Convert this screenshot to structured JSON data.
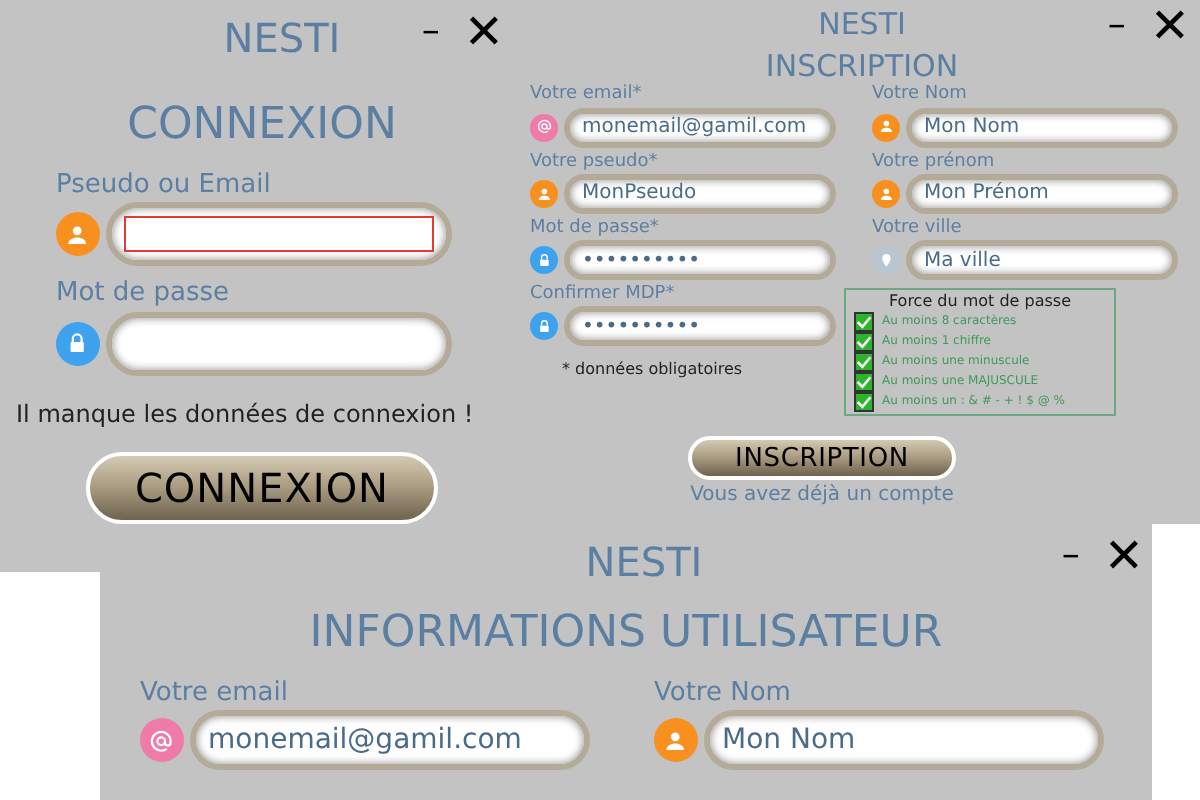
{
  "login_window": {
    "app_title": "NESTI",
    "minimize": "–",
    "close": "✕",
    "heading": "CONNEXION",
    "fields": [
      {
        "label": "Pseudo ou Email",
        "kind": "user",
        "invalid": true
      },
      {
        "label": "Mot de passe",
        "kind": "password",
        "invalid": false
      }
    ],
    "error": "Il manque les données de connexion !",
    "button": "CONNEXION"
  },
  "signup_window": {
    "app_title": "NESTI",
    "minimize": "–",
    "close": "✕",
    "heading": "INSCRIPTION",
    "left_fields": [
      {
        "label": "Votre email*",
        "kind": "email",
        "value": "monemail@gamil.com"
      },
      {
        "label": "Votre pseudo*",
        "kind": "user",
        "value": "MonPseudo"
      },
      {
        "label": "Mot de passe*",
        "kind": "password",
        "value": "••••••••••"
      },
      {
        "label": "Confirmer MDP*",
        "kind": "password",
        "value": "••••••••••"
      }
    ],
    "right_fields": [
      {
        "label": "Votre Nom",
        "kind": "user",
        "value": "Mon Nom"
      },
      {
        "label": "Votre prénom",
        "kind": "user",
        "value": "Mon Prénom"
      },
      {
        "label": "Votre ville",
        "kind": "city",
        "value": "Ma ville"
      }
    ],
    "required_note": "* données obligatoires",
    "strength": {
      "title": "Force du mot de passe",
      "rules": [
        {
          "text": "Au moins 8 caractères",
          "checked": true
        },
        {
          "text": "Au moins 1 chiffre",
          "checked": true
        },
        {
          "text": "Au moins une minuscule",
          "checked": true
        },
        {
          "text": "Au moins une MAJUSCULE",
          "checked": true
        },
        {
          "text": "Au moins un : & # - + ! $ @ %",
          "checked": true
        }
      ]
    },
    "button": "INSCRIPTION",
    "link": "Vous avez déjà un compte"
  },
  "profile_window": {
    "app_title": "NESTI",
    "minimize": "–",
    "close": "✕",
    "heading": "INFORMATIONS UTILISATEUR",
    "fields": [
      {
        "label": "Votre email",
        "kind": "email",
        "value": "monemail@gamil.com"
      },
      {
        "label": "Votre Nom",
        "kind": "user",
        "value": "Mon Nom"
      }
    ]
  }
}
